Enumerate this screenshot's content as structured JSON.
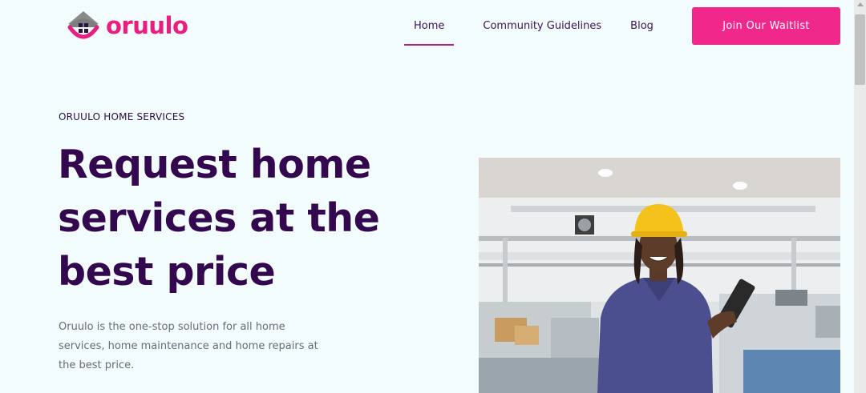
{
  "brand": {
    "name": "oruulo",
    "color": "#e91e80"
  },
  "nav": {
    "items": [
      {
        "label": "Home",
        "active": true
      },
      {
        "label": "Community Guidelines",
        "active": false
      },
      {
        "label": "Blog",
        "active": false
      }
    ],
    "cta": "Join Our Waitlist"
  },
  "hero": {
    "eyebrow": "ORUULO HOME SERVICES",
    "headline": "Request home services at the best price",
    "description": "Oruulo is the one-stop solution for all home services, home maintenance and home repairs at the best price."
  },
  "colors": {
    "background": "#f2fcfd",
    "accent": "#f0288c",
    "heading": "#33084f"
  }
}
